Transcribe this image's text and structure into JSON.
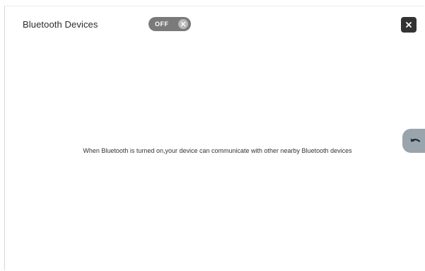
{
  "header": {
    "title": "Bluetooth Devices",
    "toggle": {
      "label": "OFF",
      "state": "off"
    }
  },
  "main": {
    "message": "When Bluetooth is turned on,your device can communicate with other nearby Bluetooth devices"
  },
  "icons": {
    "close": "close-icon",
    "toggle_knob": "close-icon",
    "back": "undo-arrow-icon"
  },
  "colors": {
    "toggle_off": "#7a7a7a",
    "close_button": "#333333",
    "back_button": "#9aa4ad"
  }
}
